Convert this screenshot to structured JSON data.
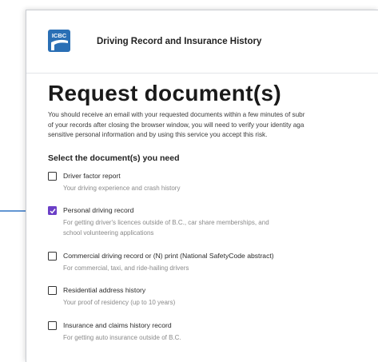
{
  "header": {
    "logo_text": "ICBC",
    "title": "Driving Record and Insurance History"
  },
  "page_title": "Request document(s)",
  "intro": [
    "You should receive an email with your requested documents within a few minutes of subr",
    "of your records after closing the browser window, you will need to verify your identity aga",
    "sensitive personal information and by using this service you accept this risk."
  ],
  "section_label": "Select the document(s) you need",
  "options": [
    {
      "title": "Driver factor report",
      "desc": [
        "Your driving experience and crash history"
      ],
      "checked": false
    },
    {
      "title": "Personal driving record",
      "desc": [
        "For getting driver's licences outside of B.C., car share memberships, and",
        "school volunteering applications"
      ],
      "checked": true
    },
    {
      "title": "Commercial driving record or (N) print (National SafetyCode abstract)",
      "desc": [
        "For commercial, taxi, and ride-hailing drivers"
      ],
      "checked": false
    },
    {
      "title": "Residential address history",
      "desc": [
        "Your proof of residency (up to 10 years)"
      ],
      "checked": false
    },
    {
      "title": "Insurance and claims history record",
      "desc": [
        "For getting auto insurance outside of B.C."
      ],
      "checked": false
    }
  ],
  "colors": {
    "brand": "#2a6fb5",
    "checkbox_checked": "#6b3fc7",
    "arrow": "#2f73c4"
  }
}
